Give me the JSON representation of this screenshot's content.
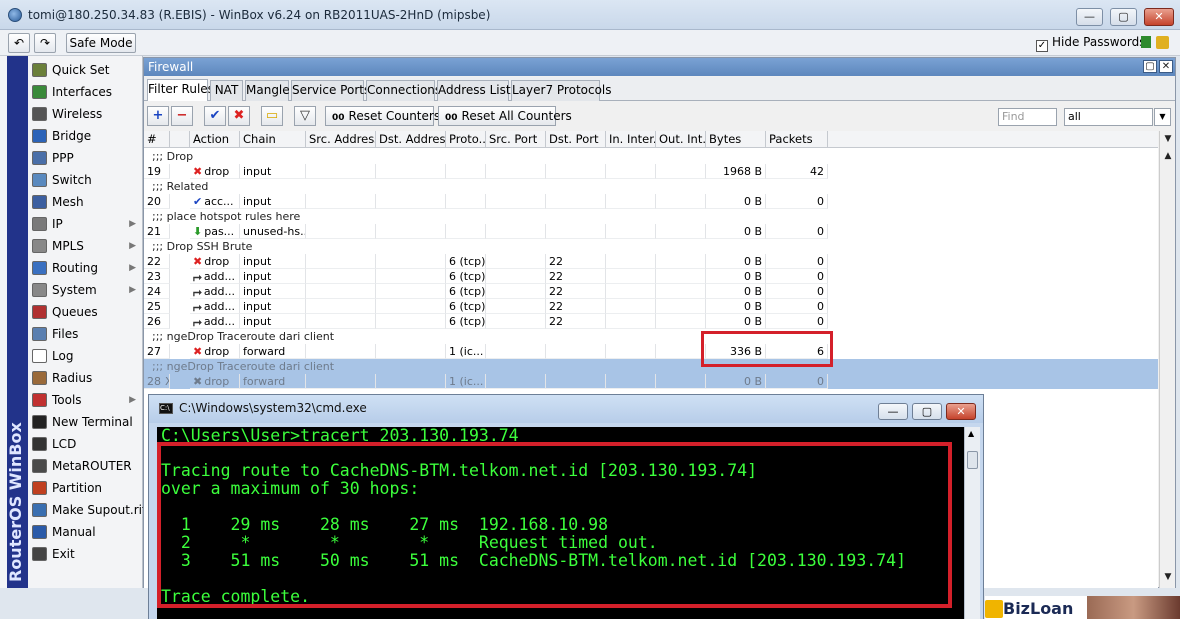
{
  "window": {
    "title": "tomi@180.250.34.83 (R.EBIS) - WinBox v6.24 on RB2011UAS-2HnD (mipsbe)",
    "btn_min": "—",
    "btn_max": "▢",
    "btn_close": "✕"
  },
  "toolbar": {
    "undo_icon": "↶",
    "redo_icon": "↷",
    "safe_mode": "Safe Mode",
    "hide_passwords": "Hide Passwords",
    "hide_passwords_checked": "✓"
  },
  "sidebar": {
    "brand": "RouterOS WinBox",
    "items": [
      {
        "label": "Quick Set",
        "icon": "quick-set-icon",
        "color": "#6a7f3a",
        "sub": ""
      },
      {
        "label": "Interfaces",
        "icon": "interfaces-icon",
        "color": "#3a8a3a",
        "sub": ""
      },
      {
        "label": "Wireless",
        "icon": "wireless-icon",
        "color": "#555555",
        "sub": ""
      },
      {
        "label": "Bridge",
        "icon": "bridge-icon",
        "color": "#2b63b8",
        "sub": ""
      },
      {
        "label": "PPP",
        "icon": "ppp-icon",
        "color": "#4a6fa8",
        "sub": ""
      },
      {
        "label": "Switch",
        "icon": "switch-icon",
        "color": "#5a8abf",
        "sub": ""
      },
      {
        "label": "Mesh",
        "icon": "mesh-icon",
        "color": "#3c5fa0",
        "sub": ""
      },
      {
        "label": "IP",
        "icon": "ip-icon",
        "color": "#7a7a7a",
        "sub": "▶"
      },
      {
        "label": "MPLS",
        "icon": "mpls-icon",
        "color": "#888888",
        "sub": "▶"
      },
      {
        "label": "Routing",
        "icon": "routing-icon",
        "color": "#3a70c0",
        "sub": "▶"
      },
      {
        "label": "System",
        "icon": "system-icon",
        "color": "#888888",
        "sub": "▶"
      },
      {
        "label": "Queues",
        "icon": "queues-icon",
        "color": "#b03030",
        "sub": ""
      },
      {
        "label": "Files",
        "icon": "files-icon",
        "color": "#5a7fb0",
        "sub": ""
      },
      {
        "label": "Log",
        "icon": "log-icon",
        "color": "#ffffff",
        "sub": ""
      },
      {
        "label": "Radius",
        "icon": "radius-icon",
        "color": "#9a6a3a",
        "sub": ""
      },
      {
        "label": "Tools",
        "icon": "tools-icon",
        "color": "#c03030",
        "sub": "▶"
      },
      {
        "label": "New Terminal",
        "icon": "terminal-icon",
        "color": "#222222",
        "sub": ""
      },
      {
        "label": "LCD",
        "icon": "lcd-icon",
        "color": "#333333",
        "sub": ""
      },
      {
        "label": "MetaROUTER",
        "icon": "metarouter-icon",
        "color": "#4a4a4a",
        "sub": ""
      },
      {
        "label": "Partition",
        "icon": "partition-icon",
        "color": "#c04020",
        "sub": ""
      },
      {
        "label": "Make Supout.rif",
        "icon": "supout-icon",
        "color": "#3a6fb0",
        "sub": ""
      },
      {
        "label": "Manual",
        "icon": "manual-icon",
        "color": "#2a5aa8",
        "sub": ""
      },
      {
        "label": "Exit",
        "icon": "exit-icon",
        "color": "#444444",
        "sub": ""
      }
    ]
  },
  "firewall": {
    "title": "Firewall",
    "tabs": [
      "Filter Rules",
      "NAT",
      "Mangle",
      "Service Ports",
      "Connections",
      "Address Lists",
      "Layer7 Protocols"
    ],
    "reset_counters": "Reset Counters",
    "reset_all_counters": "Reset All Counters",
    "find_placeholder": "Find",
    "filter_value": "all",
    "columns": [
      "#",
      "",
      "Action",
      "Chain",
      "Src. Address",
      "Dst. Address",
      "Proto...",
      "Src. Port",
      "Dst. Port",
      "In. Inter...",
      "Out. Int...",
      "Bytes",
      "Packets"
    ],
    "rows": [
      {
        "type": "comment",
        "text": ";;; Drop"
      },
      {
        "type": "rule",
        "num": "19",
        "flag": "",
        "action_icon": "✖",
        "action_class": "act-drop",
        "action": "drop",
        "chain": "input",
        "proto": "",
        "dst_port": "",
        "bytes": "1968 B",
        "packets": "42"
      },
      {
        "type": "comment",
        "text": ";;; Related"
      },
      {
        "type": "rule",
        "num": "20",
        "flag": "",
        "action_icon": "✔",
        "action_class": "act-accept",
        "action": "acc...",
        "chain": "input",
        "proto": "",
        "dst_port": "",
        "bytes": "0 B",
        "packets": "0"
      },
      {
        "type": "comment",
        "text": ";;; place hotspot rules here"
      },
      {
        "type": "rule",
        "num": "21",
        "flag": "",
        "action_icon": "⬇",
        "action_class": "act-pass",
        "action": "pas...",
        "chain": "unused-hs...",
        "proto": "",
        "dst_port": "",
        "bytes": "0 B",
        "packets": "0"
      },
      {
        "type": "comment",
        "text": ";;; Drop SSH Brute"
      },
      {
        "type": "rule",
        "num": "22",
        "flag": "",
        "action_icon": "✖",
        "action_class": "act-drop",
        "action": "drop",
        "chain": "input",
        "proto": "6 (tcp)",
        "dst_port": "22",
        "bytes": "0 B",
        "packets": "0"
      },
      {
        "type": "rule",
        "num": "23",
        "flag": "",
        "action_icon": "⮣",
        "action_class": "act-add",
        "action": "add...",
        "chain": "input",
        "proto": "6 (tcp)",
        "dst_port": "22",
        "bytes": "0 B",
        "packets": "0"
      },
      {
        "type": "rule",
        "num": "24",
        "flag": "",
        "action_icon": "⮣",
        "action_class": "act-add",
        "action": "add...",
        "chain": "input",
        "proto": "6 (tcp)",
        "dst_port": "22",
        "bytes": "0 B",
        "packets": "0"
      },
      {
        "type": "rule",
        "num": "25",
        "flag": "",
        "action_icon": "⮣",
        "action_class": "act-add",
        "action": "add...",
        "chain": "input",
        "proto": "6 (tcp)",
        "dst_port": "22",
        "bytes": "0 B",
        "packets": "0"
      },
      {
        "type": "rule",
        "num": "26",
        "flag": "",
        "action_icon": "⮣",
        "action_class": "act-add",
        "action": "add...",
        "chain": "input",
        "proto": "6 (tcp)",
        "dst_port": "22",
        "bytes": "0 B",
        "packets": "0"
      },
      {
        "type": "comment",
        "text": ";;; ngeDrop Traceroute dari client"
      },
      {
        "type": "rule",
        "num": "27",
        "flag": "",
        "action_icon": "✖",
        "action_class": "act-drop",
        "action": "drop",
        "chain": "forward",
        "proto": "1 (ic...",
        "dst_port": "",
        "bytes": "336 B",
        "packets": "6"
      },
      {
        "type": "comment-selected",
        "text": ";;; ngeDrop Traceroute dari client"
      },
      {
        "type": "rule-selected",
        "num": "28",
        "flag": "X",
        "action_icon": "✖",
        "action_class": "",
        "action": "drop",
        "chain": "forward",
        "proto": "1 (ic...",
        "dst_port": "",
        "bytes": "0 B",
        "packets": "0"
      }
    ]
  },
  "cmd": {
    "title": "C:\\Windows\\system32\\cmd.exe",
    "lines": [
      "C:\\Users\\User>tracert 203.130.193.74",
      "",
      "Tracing route to CacheDNS-BTM.telkom.net.id [203.130.193.74]",
      "over a maximum of 30 hops:",
      "",
      "  1    29 ms    28 ms    27 ms  192.168.10.98",
      "  2     *        *        *     Request timed out.",
      "  3    51 ms    50 ms    51 ms  CacheDNS-BTM.telkom.net.id [203.130.193.74]",
      "",
      "Trace complete."
    ]
  },
  "ad": {
    "text": "BizLoan"
  }
}
